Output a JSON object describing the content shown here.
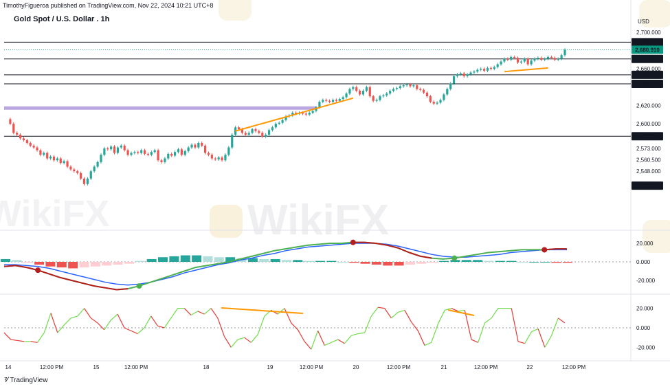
{
  "header": {
    "published": "TimothyFigueroa published on TradingView.com, Nov 22, 2024 10:21 UTC+8",
    "title": "Gold Spot / U.S. Dollar . 1h",
    "currency": "USD"
  },
  "footer": {
    "brand": "TradingView"
  },
  "watermark": "WikiFX",
  "colors": {
    "up": "#26a69a",
    "down": "#ef5350",
    "resistance_zone": "#b39ddb",
    "trendline": "#ff9800",
    "macd_line": "#4caf50",
    "signal_line": "#2962ff",
    "cross_down": "#b71c1c",
    "osc": "#6fdc4a",
    "osc_down": "#e53935",
    "current_price_bg": "#089981"
  },
  "chart_data": [
    {
      "type": "candlestick",
      "title": "Gold Spot / U.S. Dollar . 1h",
      "ylabel": "USD",
      "y_ticks": [
        "2,700.000",
        "2,680.000",
        "2,660.000",
        "2,620.000",
        "2,600.000",
        "2,573.000",
        "2,560.500",
        "2,548.000"
      ],
      "x_ticks": [
        "14",
        "12:00 PM",
        "15",
        "12:00 PM",
        "18",
        "19",
        "12:00 PM",
        "20",
        "12:00 PM",
        "21",
        "12:00 PM",
        "22",
        "12:00 PM"
      ],
      "price_levels": [
        {
          "label": "2,689.197",
          "value": 2689.197,
          "style": "line"
        },
        {
          "label": "2,680.910",
          "value": 2680.91,
          "style": "current"
        },
        {
          "label": "2,670.882",
          "value": 2670.882,
          "style": "line"
        },
        {
          "label": "2,653.515",
          "value": 2653.515,
          "style": "line"
        },
        {
          "label": "2,643.644",
          "value": 2643.644,
          "style": "line"
        },
        {
          "label": "2,586.289",
          "value": 2586.289,
          "style": "line"
        },
        {
          "label": "2,532.239",
          "value": 2532.239,
          "style": "marker"
        }
      ],
      "resistance_zone": [
        2616,
        2619
      ],
      "trendlines": [
        {
          "from": [
            68,
            2592
          ],
          "to": [
            103,
            2628
          ]
        },
        {
          "from": [
            148,
            2657
          ],
          "to": [
            161,
            2661
          ]
        }
      ],
      "candles_close": [
        2605,
        2600,
        2590,
        2588,
        2584,
        2582,
        2579,
        2576,
        2574,
        2571,
        2566,
        2568,
        2562,
        2564,
        2560,
        2562,
        2557,
        2559,
        2553,
        2550,
        2548,
        2546,
        2540,
        2534,
        2540,
        2548,
        2553,
        2558,
        2566,
        2573,
        2572,
        2575,
        2568,
        2574,
        2576,
        2571,
        2566,
        2568,
        2569,
        2568,
        2571,
        2567,
        2566,
        2569,
        2571,
        2560,
        2558,
        2562,
        2567,
        2565,
        2569,
        2572,
        2566,
        2570,
        2574,
        2577,
        2574,
        2579,
        2576,
        2568,
        2566,
        2562,
        2561,
        2563,
        2560,
        2566,
        2574,
        2588,
        2596,
        2594,
        2590,
        2588,
        2590,
        2594,
        2592,
        2590,
        2586,
        2588,
        2593,
        2596,
        2600,
        2601,
        2604,
        2608,
        2609,
        2612,
        2611,
        2612,
        2611,
        2610,
        2612,
        2614,
        2618,
        2624,
        2626,
        2625,
        2624,
        2626,
        2625,
        2627,
        2629,
        2633,
        2638,
        2640,
        2636,
        2632,
        2636,
        2640,
        2630,
        2625,
        2626,
        2630,
        2631,
        2633,
        2636,
        2638,
        2639,
        2641,
        2642,
        2643,
        2641,
        2642,
        2638,
        2637,
        2634,
        2630,
        2624,
        2622,
        2623,
        2626,
        2632,
        2638,
        2644,
        2652,
        2654,
        2655,
        2652,
        2654,
        2656,
        2657,
        2659,
        2660,
        2658,
        2661,
        2660,
        2662,
        2665,
        2668,
        2671,
        2670,
        2673,
        2672,
        2667,
        2668,
        2671,
        2665,
        2669,
        2671,
        2672,
        2670,
        2671,
        2673,
        2672,
        2670,
        2671,
        2675,
        2681
      ],
      "macd_line": [
        -5,
        -4,
        -6,
        -9,
        -13,
        -17,
        -20,
        -23,
        -26,
        -28,
        -30,
        -29,
        -26,
        -22,
        -18,
        -14,
        -10,
        -6,
        -4,
        -2,
        0,
        3,
        6,
        9,
        12,
        14,
        16,
        18,
        19,
        20,
        20,
        21,
        21,
        20,
        18,
        15,
        10,
        6,
        4,
        3,
        4,
        6,
        8,
        10,
        11,
        12,
        13,
        13,
        13,
        14,
        14
      ],
      "signal_line": [
        -3,
        -3,
        -4,
        -5,
        -7,
        -10,
        -13,
        -16,
        -19,
        -22,
        -24,
        -25,
        -24,
        -22,
        -19,
        -16,
        -12,
        -9,
        -6,
        -3,
        -1,
        2,
        4,
        7,
        9,
        12,
        14,
        16,
        17,
        18,
        19,
        20,
        20,
        20,
        19,
        17,
        14,
        11,
        8,
        6,
        5,
        5,
        6,
        7,
        8,
        10,
        11,
        12,
        13,
        13,
        13
      ],
      "macd_histogram": [
        3,
        2,
        -1,
        -3,
        -5,
        -6,
        -7,
        -6,
        -5,
        -4,
        -3,
        -2,
        1,
        3,
        5,
        6,
        7,
        7,
        6,
        5,
        5,
        4,
        4,
        3,
        3,
        2,
        2,
        1,
        1,
        1,
        0,
        -1,
        -2,
        -3,
        -4,
        -4,
        -3,
        -2,
        -1,
        1,
        2,
        2,
        2,
        1,
        1,
        1,
        0,
        0,
        0,
        -1,
        -1
      ],
      "macd_ticks": [
        "20.000",
        "0.000",
        "-20.000"
      ],
      "oscillator": [
        -5,
        -12,
        -13,
        -14,
        -14,
        -15,
        -5,
        15,
        -5,
        3,
        10,
        12,
        20,
        10,
        5,
        -2,
        8,
        14,
        0,
        -3,
        -6,
        0,
        12,
        2,
        0,
        10,
        20,
        20,
        13,
        17,
        14,
        20,
        10,
        -9,
        -20,
        -12,
        -10,
        -15,
        -7,
        12,
        18,
        14,
        20,
        5,
        -2,
        -14,
        -22,
        -3,
        -18,
        -15,
        -12,
        -16,
        -8,
        -6,
        -5,
        12,
        21,
        20,
        10,
        16,
        18,
        6,
        -3,
        -18,
        -15,
        4,
        18,
        20,
        17,
        18,
        -12,
        -15,
        5,
        10,
        20,
        20,
        20,
        -14,
        -16,
        -4,
        -1,
        -20,
        -8,
        10,
        5
      ],
      "oscillator_ticks": [
        "20.000",
        "0.000",
        "-20.000"
      ]
    }
  ]
}
